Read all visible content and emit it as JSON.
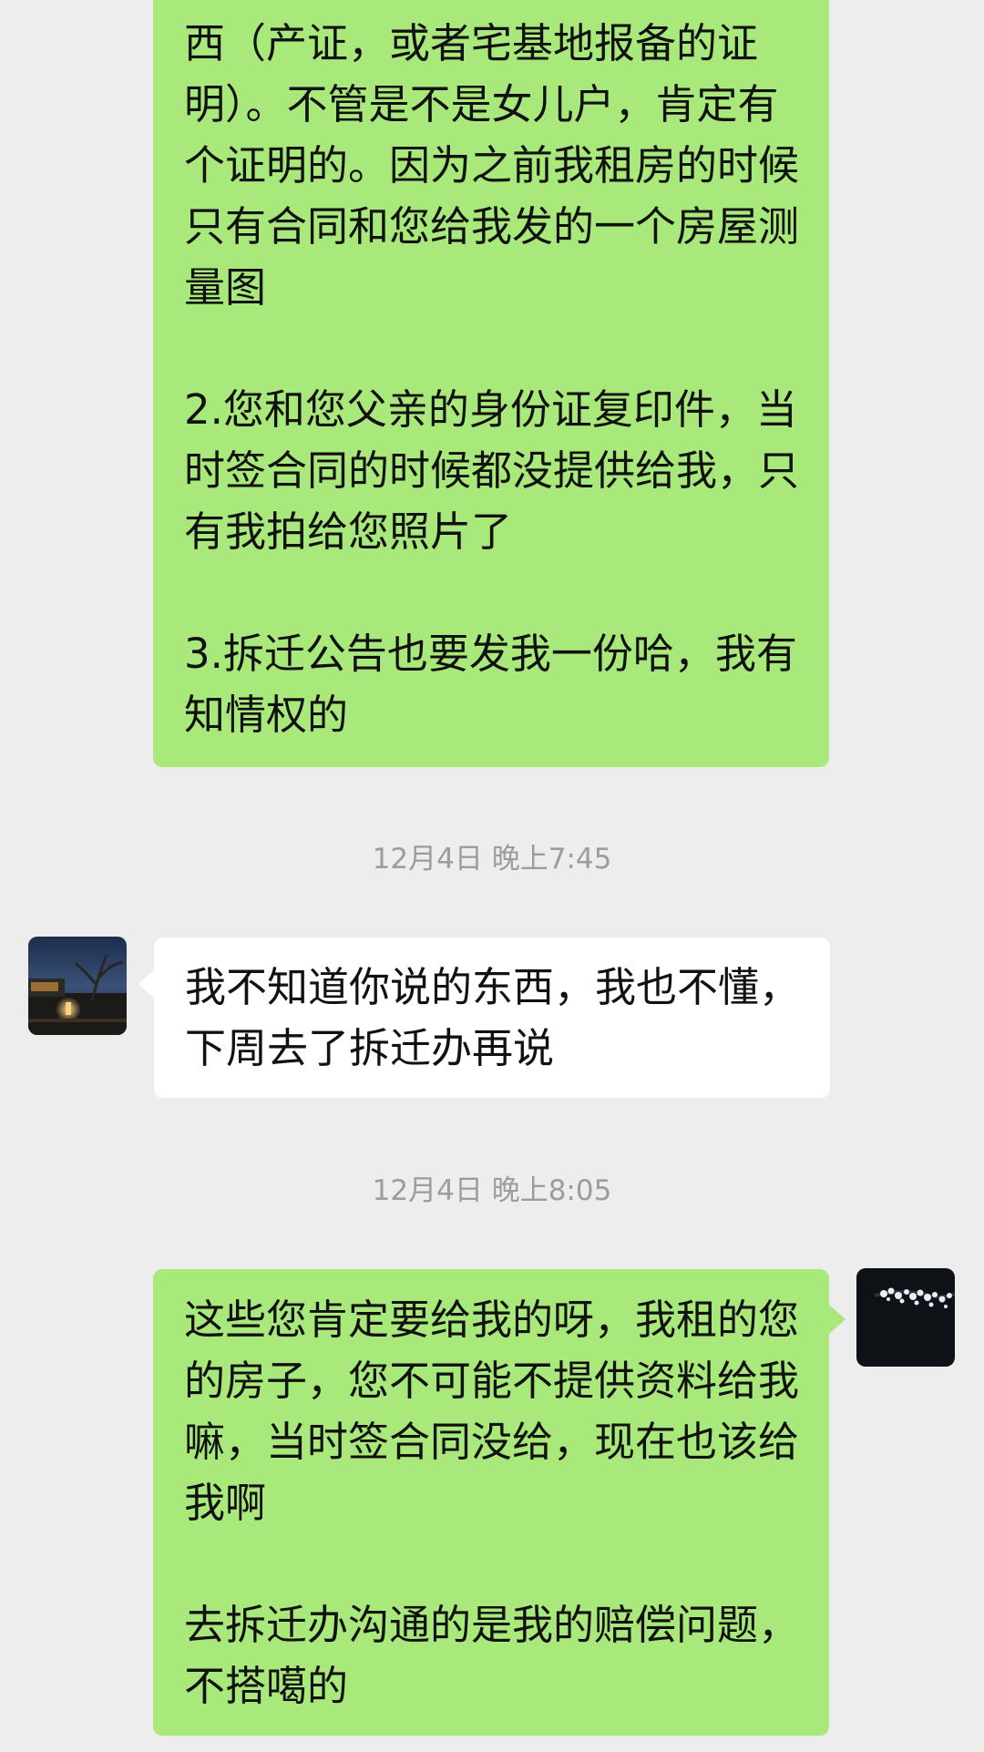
{
  "messages": [
    {
      "direction": "outgoing",
      "text": "西（产证，或者宅基地报备的证明）。不管是不是女儿户，肯定有个证明的。因为之前我租房的时候只有合同和您给我发的一个房屋测量图\n\n2.您和您父亲的身份证复印件，当时签合同的时候都没提供给我，只有我拍给您照片了\n\n3.拆迁公告也要发我一份哈，我有知情权的"
    },
    {
      "timestamp": "12月4日 晚上7:45"
    },
    {
      "direction": "incoming",
      "avatar_icon": "night-garden-avatar",
      "text": "我不知道你说的东西，我也不懂，下周去了拆迁办再说"
    },
    {
      "timestamp": "12月4日 晚上8:05"
    },
    {
      "direction": "outgoing",
      "avatar_icon": "blossom-avatar",
      "text": "这些您肯定要给我的呀，我租的您的房子，您不可能不提供资料给我嘛，当时签合同没给，现在也该给我啊\n\n去拆迁办沟通的是我的赔偿问题，不搭噶的"
    }
  ],
  "colors": {
    "background": "#ededed",
    "outgoing_bubble": "#a9e87a",
    "incoming_bubble": "#ffffff",
    "timestamp_text": "#9c9c9c"
  }
}
